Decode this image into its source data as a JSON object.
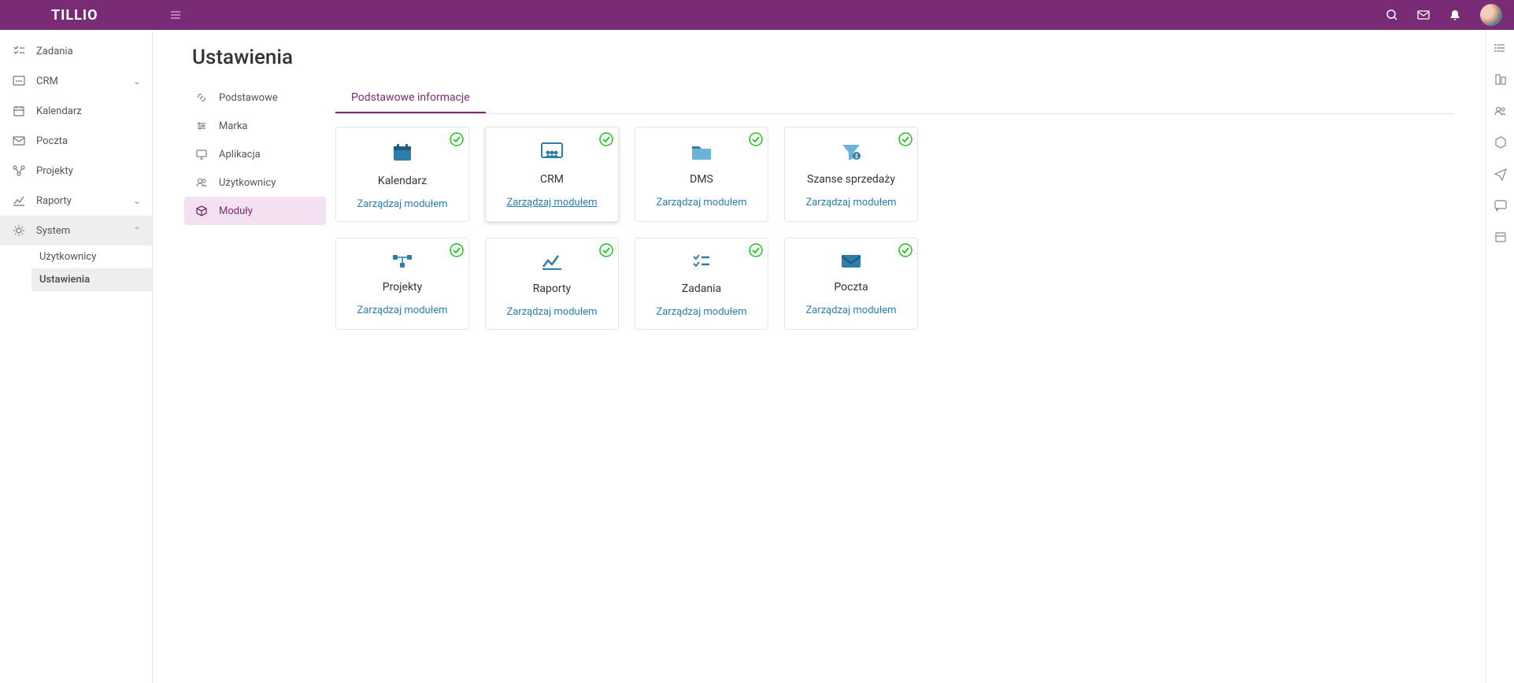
{
  "header": {
    "brand": "TILLIO"
  },
  "sidebar": {
    "items": [
      {
        "label": "Zadania"
      },
      {
        "label": "CRM"
      },
      {
        "label": "Kalendarz"
      },
      {
        "label": "Poczta"
      },
      {
        "label": "Projekty"
      },
      {
        "label": "Raporty"
      },
      {
        "label": "System"
      }
    ],
    "system_sub": [
      {
        "label": "Użytkownicy"
      },
      {
        "label": "Ustawienia"
      }
    ]
  },
  "page": {
    "title": "Ustawienia",
    "tab_active": "Podstawowe informacje"
  },
  "settings_nav": [
    {
      "label": "Podstawowe"
    },
    {
      "label": "Marka"
    },
    {
      "label": "Aplikacja"
    },
    {
      "label": "Użytkownicy"
    },
    {
      "label": "Moduły"
    }
  ],
  "modules": [
    {
      "name": "Kalendarz",
      "link": "Zarządzaj modułem"
    },
    {
      "name": "CRM",
      "link": "Zarządzaj modułem"
    },
    {
      "name": "DMS",
      "link": "Zarządzaj modułem"
    },
    {
      "name": "Szanse sprzedaży",
      "link": "Zarządzaj modułem"
    },
    {
      "name": "Projekty",
      "link": "Zarządzaj modułem"
    },
    {
      "name": "Raporty",
      "link": "Zarządzaj modułem"
    },
    {
      "name": "Zadania",
      "link": "Zarządzaj modułem"
    },
    {
      "name": "Poczta",
      "link": "Zarządzaj modułem"
    }
  ],
  "colors": {
    "brand": "#792c75",
    "link": "#2d7faa",
    "status_ok": "#1ec41e"
  }
}
